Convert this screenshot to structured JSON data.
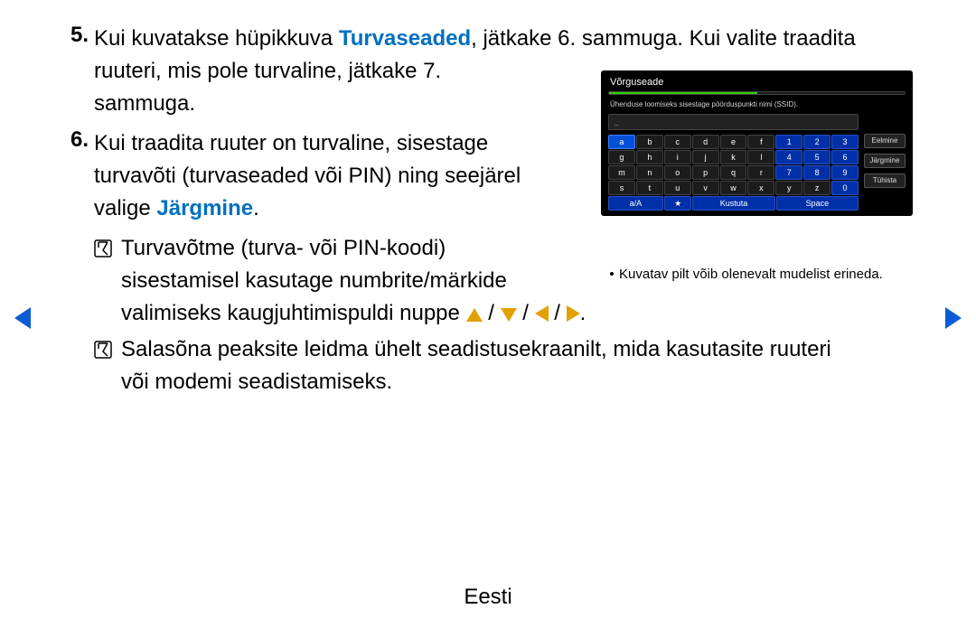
{
  "list5_num": "5.",
  "list5_pre": "Kui kuvatakse hüpikkuva ",
  "list5_hl": "Turvaseaded",
  "list5_post": ", jätkake 6. sammuga. Kui valite traadita",
  "list5_line2": "ruuteri, mis pole turvaline, jätkake 7.",
  "list5_line3": "sammuga.",
  "list6_num": "6.",
  "list6_line1": "Kui traadita ruuter on turvaline, sisestage",
  "list6_line2": "turvavõti (turvaseaded või PIN) ning seejärel",
  "list6_line3_pre": "valige ",
  "list6_line3_hl": "Järgmine",
  "list6_line3_post": ".",
  "note1_line1": "Turvavõtme (turva- või PIN-koodi)",
  "note1_line2": "sisestamisel kasutage numbrite/märkide",
  "note1_line3_pre": "valimiseks kaugjuhtimispuldi nuppe ",
  "note1_slash": " / ",
  "note1_end": ".",
  "note2_line1": "Salasõna peaksite leidma ühelt seadistusekraanilt, mida kasutasite ruuteri",
  "note2_line2": "või modemi seadistamiseks.",
  "footer": "Eesti",
  "net": {
    "title": "Võrguseade",
    "instr": "Ühenduse loomiseks sisestage pöörduspunkti nimi (SSID).",
    "input": "_",
    "rows": [
      [
        "a",
        "b",
        "c",
        "d",
        "e",
        "f",
        "1",
        "2",
        "3"
      ],
      [
        "g",
        "h",
        "i",
        "j",
        "k",
        "l",
        "4",
        "5",
        "6"
      ],
      [
        "m",
        "n",
        "o",
        "p",
        "q",
        "r",
        "7",
        "8",
        "9"
      ],
      [
        "s",
        "t",
        "u",
        "v",
        "w",
        "x",
        "y",
        "z",
        "0"
      ]
    ],
    "act_aA": "a/A",
    "act_star": "★",
    "act_del": "Kustuta",
    "act_space": "Space",
    "btn_prev": "Eelmine",
    "btn_next": "Järgmine",
    "btn_cancel": "Tühista",
    "caption": "Kuvatav pilt võib olenevalt mudelist erineda."
  }
}
